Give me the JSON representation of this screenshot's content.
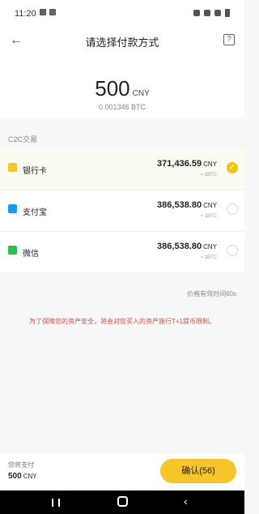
{
  "status_bar": {
    "time": "11:20"
  },
  "header": {
    "title": "请选择付款方式",
    "help_icon": "?"
  },
  "amount": {
    "value": "500",
    "currency": "CNY",
    "btc": "0.001346 BTC"
  },
  "section_label": "C2C交易",
  "payments": [
    {
      "name": "银行卡",
      "price": "371,436.59",
      "currency": "CNY",
      "per": "≈ 1BTC",
      "selected": true,
      "icon_color": "#f3c623"
    },
    {
      "name": "支付宝",
      "price": "386,538.80",
      "currency": "CNY",
      "per": "≈ 1BTC",
      "selected": false,
      "icon_color": "#1a9bea"
    },
    {
      "name": "微信",
      "price": "386,538.80",
      "currency": "CNY",
      "per": "≈ 1BTC",
      "selected": false,
      "icon_color": "#2dbd4a"
    }
  ],
  "valid_text": "价格有效时间60s",
  "notice": "为了保障您的资产安全，将会对您买入的资产施行T+1提币限制。",
  "footer": {
    "pay_label": "您将支付",
    "pay_value": "500",
    "pay_currency": "CNY",
    "confirm_label": "确认(56)"
  },
  "colors": {
    "accent": "#f6c52a",
    "notice": "#d14a4a"
  }
}
